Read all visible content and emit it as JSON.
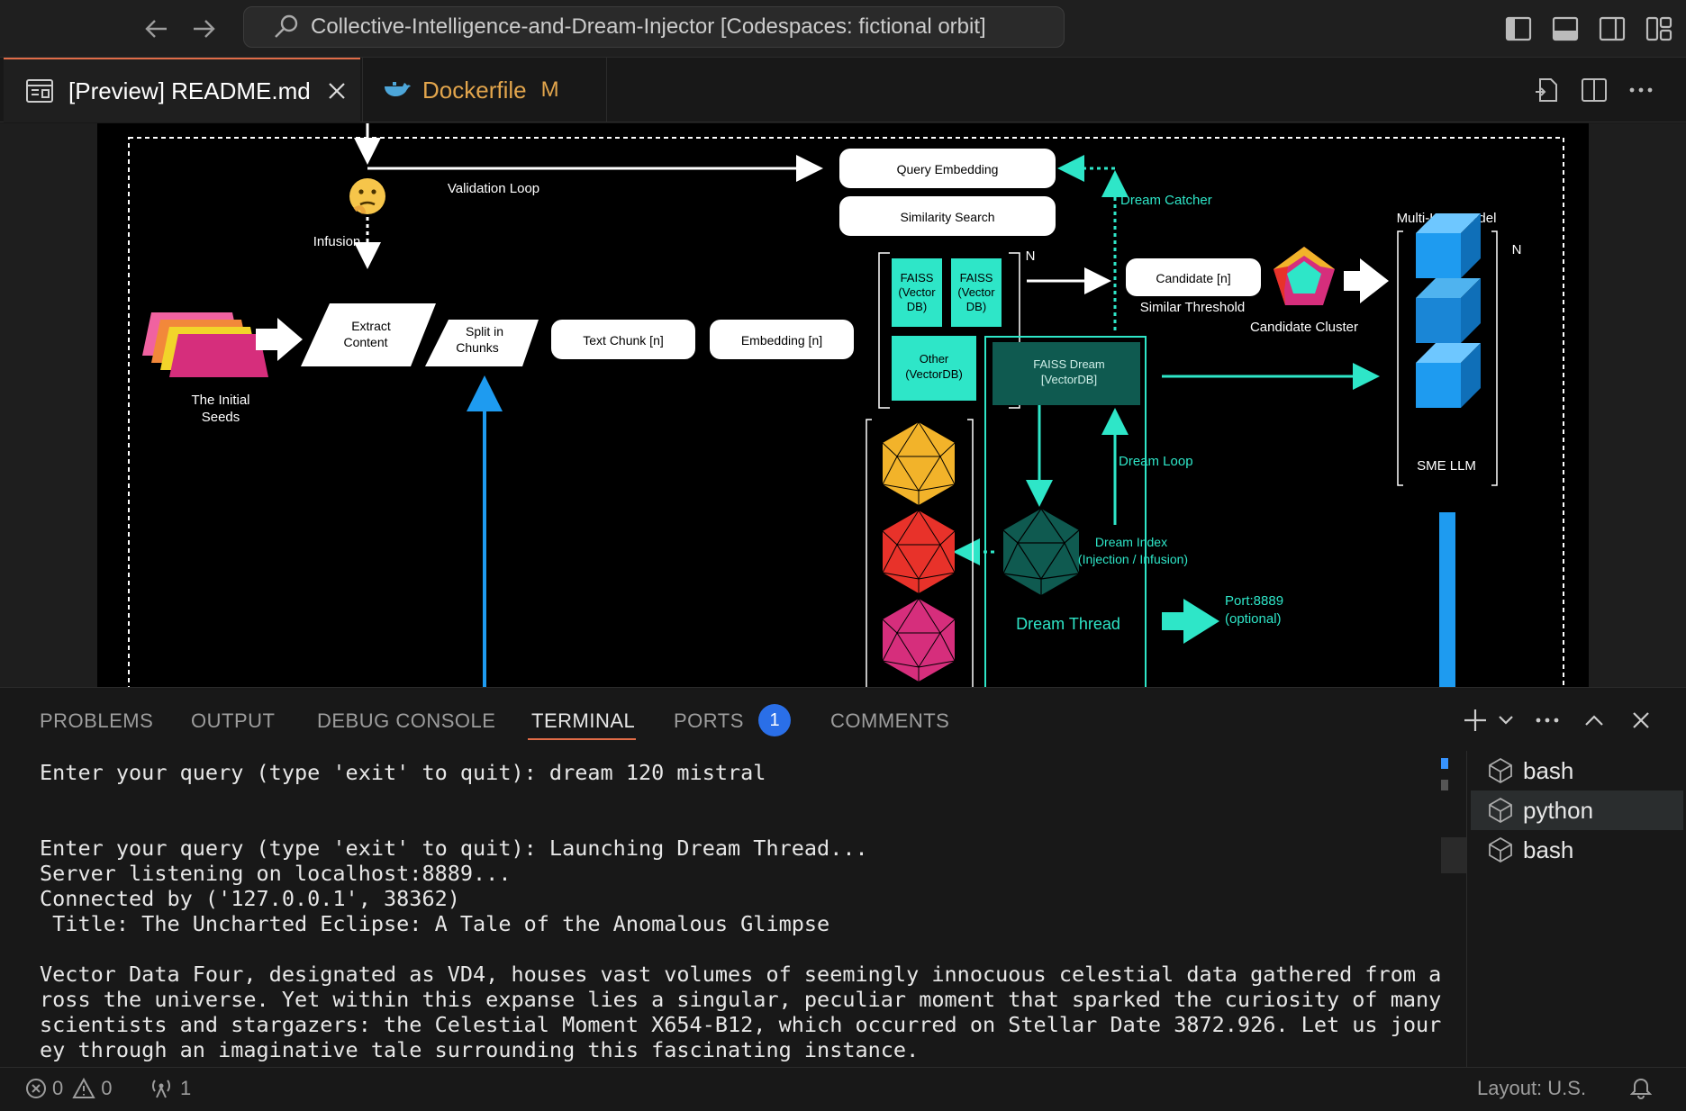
{
  "window": {
    "command_center_text": "Collective-Intelligence-and-Dream-Injector [Codespaces: fictional orbit]"
  },
  "tabs": [
    {
      "label": "[Preview] README.md",
      "icon": "preview-icon",
      "active": true
    },
    {
      "label": "Dockerfile",
      "icon": "docker-icon",
      "status": "M",
      "active": false
    }
  ],
  "diagram": {
    "labels": {
      "validation_loop": "Validation Loop",
      "infusion": "Infusion",
      "query_embedding": "Query Embedding",
      "similarity_search": "Similarity Search",
      "dream_catcher": "Dream Catcher",
      "multi_llm": "Multi-LLM Model",
      "n_top": "N",
      "n_right": "N",
      "faiss1_l1": "FAISS",
      "faiss1_l2": "(Vector",
      "faiss1_l3": "DB)",
      "faiss2_l1": "FAISS",
      "faiss2_l2": "(Vector",
      "faiss2_l3": "DB)",
      "other_l1": "Other",
      "other_l2": "(VectorDB)",
      "candidate": "Candidate [n]",
      "similar_threshold": "Similar Threshold",
      "candidate_cluster": "Candidate Cluster",
      "seeds_l1": "The Initial",
      "seeds_l2": "Seeds",
      "extract_l1": "Extract",
      "extract_l2": "Content",
      "split_l1": "Split in",
      "split_l2": "Chunks",
      "text_chunk": "Text Chunk [n]",
      "embedding": "Embedding [n]",
      "faiss_dream_l1": "FAISS Dream",
      "faiss_dream_l2": "[VectorDB]",
      "dream_loop": "Dream Loop",
      "dream_index_l1": "Dream Index",
      "dream_index_l2": "(Injection / Infusion)",
      "dream_thread": "Dream Thread",
      "port_l1": "Port:8889",
      "port_l2": "(optional)",
      "sme_llm": "SME LLM"
    },
    "colors": {
      "teal": "#2ee6c8",
      "dark_teal": "#0f5a50",
      "blue": "#1e9bf0",
      "orange": "#f2b32a",
      "red": "#e8322a",
      "magenta": "#d62e7c"
    }
  },
  "panel": {
    "tabs": [
      "PROBLEMS",
      "OUTPUT",
      "DEBUG CONSOLE",
      "TERMINAL",
      "PORTS",
      "COMMENTS"
    ],
    "active_tab": "TERMINAL",
    "ports_badge": "1",
    "terminal_lines": [
      "Enter your query (type 'exit' to quit): dream 120 mistral",
      "",
      "",
      "Enter your query (type 'exit' to quit): Launching Dream Thread...",
      "Server listening on localhost:8889...",
      "Connected by ('127.0.0.1', 38362)",
      " Title: The Uncharted Eclipse: A Tale of the Anomalous Glimpse",
      "",
      "Vector Data Four, designated as VD4, houses vast volumes of seemingly innocuous celestial data gathered from ac",
      "ross the universe. Yet within this expanse lies a singular, peculiar moment that sparked the curiosity of many",
      "scientists and stargazers: the Celestial Moment X654-B12, which occurred on Stellar Date 3872.926. Let us journ",
      "ey through an imaginative tale surrounding this fascinating instance."
    ],
    "terminals": [
      {
        "name": "bash",
        "selected": false
      },
      {
        "name": "python",
        "selected": true
      },
      {
        "name": "bash",
        "selected": false
      }
    ]
  },
  "statusbar": {
    "errors": "0",
    "warnings": "0",
    "ports": "1",
    "layout": "Layout: U.S."
  }
}
